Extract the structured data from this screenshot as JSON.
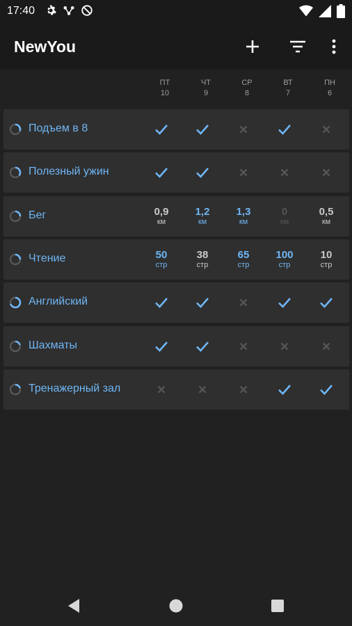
{
  "status": {
    "time": "17:40"
  },
  "app": {
    "title": "NewYou"
  },
  "days": [
    {
      "dow": "ПТ",
      "date": "10"
    },
    {
      "dow": "ЧТ",
      "date": "9"
    },
    {
      "dow": "СР",
      "date": "8"
    },
    {
      "dow": "ВТ",
      "date": "7"
    },
    {
      "dow": "ПН",
      "date": "6"
    }
  ],
  "habits": [
    {
      "name": "Подъем в 8",
      "progress": 0.3,
      "cells": [
        {
          "type": "check"
        },
        {
          "type": "check"
        },
        {
          "type": "cross"
        },
        {
          "type": "check"
        },
        {
          "type": "cross"
        }
      ]
    },
    {
      "name": "Полезный ужин",
      "progress": 0.35,
      "cells": [
        {
          "type": "check"
        },
        {
          "type": "check"
        },
        {
          "type": "cross"
        },
        {
          "type": "cross"
        },
        {
          "type": "cross"
        }
      ]
    },
    {
      "name": "Бег",
      "progress": 0.25,
      "cells": [
        {
          "type": "num",
          "value": "0,9",
          "unit": "км",
          "style": "gray"
        },
        {
          "type": "num",
          "value": "1,2",
          "unit": "км",
          "style": "blue"
        },
        {
          "type": "num",
          "value": "1,3",
          "unit": "км",
          "style": "blue"
        },
        {
          "type": "num",
          "value": "0",
          "unit": "км",
          "style": "dim"
        },
        {
          "type": "num",
          "value": "0,5",
          "unit": "км",
          "style": "gray"
        }
      ]
    },
    {
      "name": "Чтение",
      "progress": 0.25,
      "cells": [
        {
          "type": "num",
          "value": "50",
          "unit": "стр",
          "style": "blue"
        },
        {
          "type": "num",
          "value": "38",
          "unit": "стр",
          "style": "gray"
        },
        {
          "type": "num",
          "value": "65",
          "unit": "стр",
          "style": "blue"
        },
        {
          "type": "num",
          "value": "100",
          "unit": "стр",
          "style": "blue"
        },
        {
          "type": "num",
          "value": "10",
          "unit": "стр",
          "style": "gray"
        }
      ]
    },
    {
      "name": "Английский",
      "progress": 0.7,
      "cells": [
        {
          "type": "check"
        },
        {
          "type": "check"
        },
        {
          "type": "cross"
        },
        {
          "type": "check"
        },
        {
          "type": "check"
        }
      ]
    },
    {
      "name": "Шахматы",
      "progress": 0.2,
      "cells": [
        {
          "type": "check"
        },
        {
          "type": "check"
        },
        {
          "type": "cross"
        },
        {
          "type": "cross"
        },
        {
          "type": "cross"
        }
      ]
    },
    {
      "name": "Тренажерный зал",
      "progress": 0.2,
      "cells": [
        {
          "type": "cross"
        },
        {
          "type": "cross"
        },
        {
          "type": "cross"
        },
        {
          "type": "check"
        },
        {
          "type": "check"
        }
      ]
    }
  ],
  "colors": {
    "accent": "#6fb6f5",
    "card": "#2f2f2f",
    "background": "#212121",
    "bar": "#1a1a1a",
    "muted": "#555555"
  },
  "icons": {
    "status_left": [
      "gear-icon",
      "network-icon",
      "do-not-disturb-icon"
    ],
    "status_right": [
      "wifi-icon",
      "signal-icon",
      "battery-icon"
    ],
    "actions": [
      "add-icon",
      "filter-icon",
      "more-vert-icon"
    ],
    "nav": [
      "back-icon",
      "home-icon",
      "recents-icon"
    ]
  }
}
